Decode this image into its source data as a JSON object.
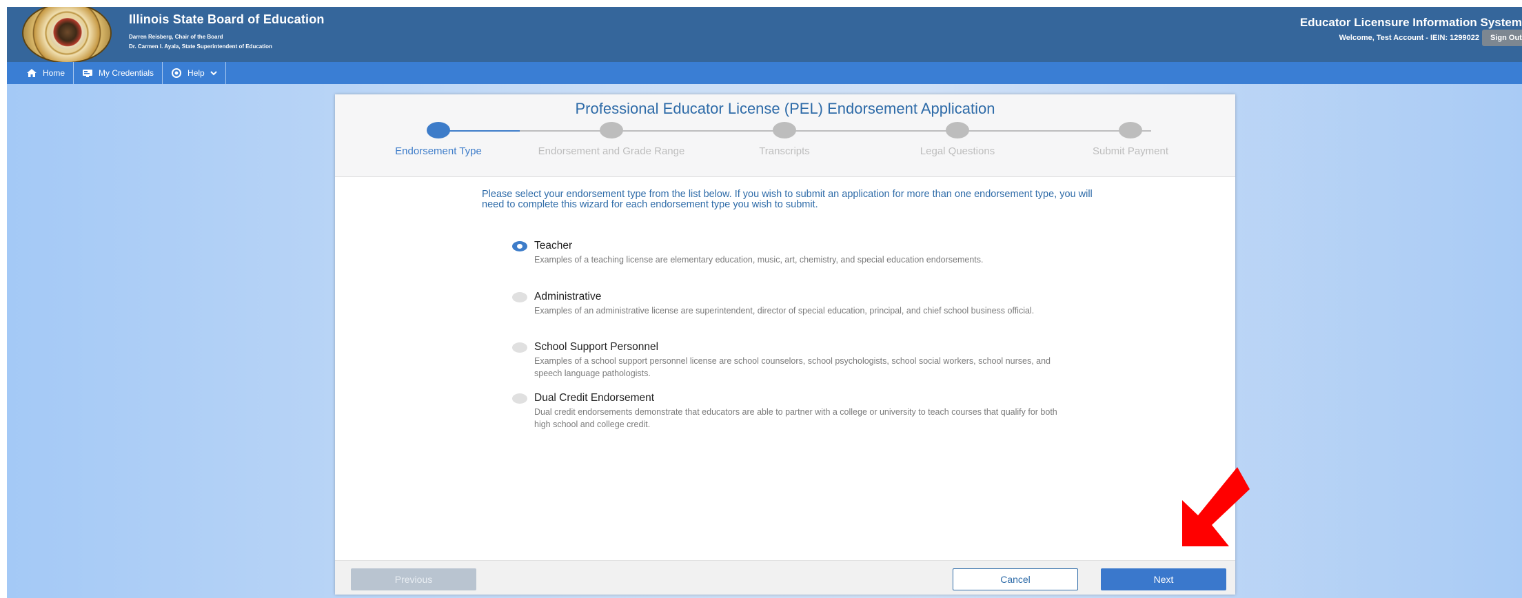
{
  "header": {
    "org_title": "Illinois State Board of Education",
    "chair_line": "Darren Reisberg, Chair of the Board",
    "superintendent_line": "Dr. Carmen I. Ayala, State Superintendent of Education",
    "system_title": "Educator Licensure Information System",
    "welcome_text": "Welcome, Test Account - IEIN: 1299022",
    "sign_out_label": "Sign Out"
  },
  "nav": {
    "home_label": "Home",
    "credentials_label": "My Credentials",
    "help_label": "Help"
  },
  "wizard": {
    "title": "Professional Educator License (PEL) Endorsement Application",
    "steps": [
      {
        "label": "Endorsement Type",
        "active": true
      },
      {
        "label": "Endorsement and Grade Range",
        "active": false
      },
      {
        "label": "Transcripts",
        "active": false
      },
      {
        "label": "Legal Questions",
        "active": false
      },
      {
        "label": "Submit Payment",
        "active": false
      }
    ],
    "intro": "Please select your endorsement type from the list below. If you wish to submit an application for more than one endorsement type, you will need to complete this wizard for each endorsement type you wish to submit.",
    "options": [
      {
        "title": "Teacher",
        "desc": "Examples of a teaching license are elementary education, music, art, chemistry, and special education endorsements.",
        "selected": true
      },
      {
        "title": "Administrative",
        "desc": "Examples of an administrative license are superintendent, director of special education, principal, and chief school business official.",
        "selected": false
      },
      {
        "title": "School Support Personnel",
        "desc": "Examples of a school support personnel license are school counselors, school psychologists, school social workers, school nurses, and speech language pathologists.",
        "selected": false
      },
      {
        "title": "Dual Credit Endorsement",
        "desc": "Dual credit endorsements demonstrate that educators are able to partner with a college or university to teach courses that qualify for both high school and college credit.",
        "selected": false
      }
    ],
    "buttons": {
      "previous": "Previous",
      "cancel": "Cancel",
      "next": "Next"
    }
  },
  "colors": {
    "header_bg": "#35669b",
    "nav_bg": "#3a7ed4",
    "accent": "#3d7cc9",
    "annotation_arrow": "#ff0000"
  }
}
